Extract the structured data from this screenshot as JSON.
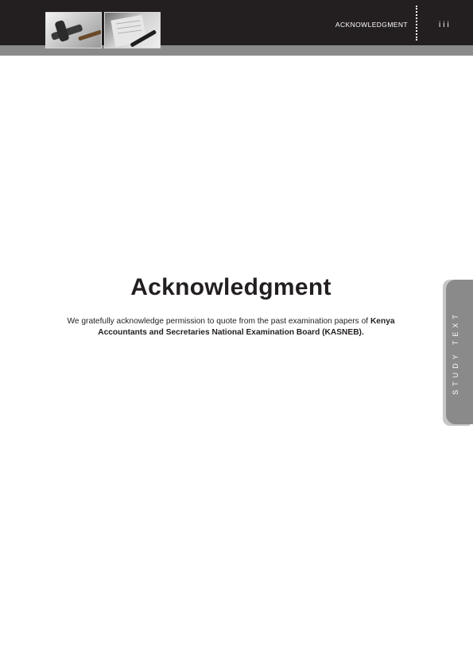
{
  "header": {
    "section_label": "ACKNOWLEDGMENT",
    "page_number": "iii"
  },
  "side_tab": {
    "label": "STUDY TEXT"
  },
  "main": {
    "title": "Acknowledgment",
    "paragraph": {
      "text_plain": "We gratefully acknowledge permission to quote from the past examination papers of",
      "text_bold": "Kenya Accountants and Secretaries National Examination Board (KASNEB)."
    }
  }
}
